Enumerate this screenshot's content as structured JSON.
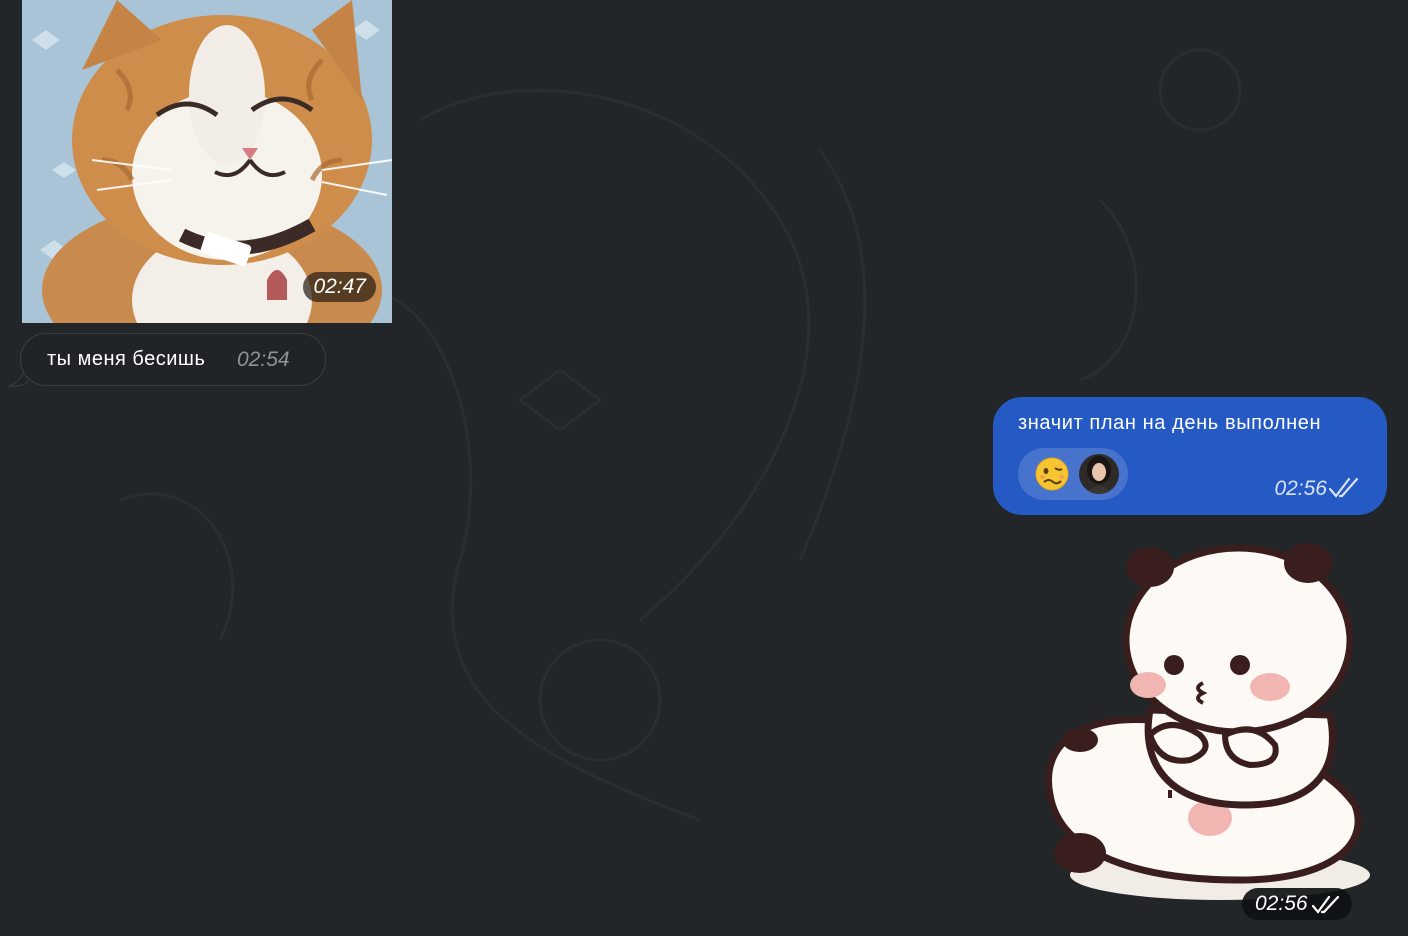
{
  "chat": {
    "background_color": "#232628",
    "messages": [
      {
        "id": "gif",
        "direction": "incoming",
        "kind": "gif",
        "media_desc_icon": "smiling-cat-gif",
        "time": "02:47"
      },
      {
        "id": "text1",
        "direction": "incoming",
        "kind": "text",
        "text": "ты меня бесишь",
        "time": "02:54"
      },
      {
        "id": "text2",
        "direction": "outgoing",
        "kind": "text",
        "text": "значит план на день выполнен",
        "time": "02:56",
        "status_icon": "double-check-icon",
        "reactions": [
          {
            "emoji": "🥴",
            "icon": "woozy-face-icon"
          },
          {
            "icon": "user-avatar"
          }
        ]
      },
      {
        "id": "sticker",
        "direction": "outgoing",
        "kind": "sticker",
        "sticker_icon": "panda-bear-hug-sticker",
        "time": "02:56",
        "status_icon": "double-check-icon"
      }
    ]
  },
  "colors": {
    "outgoing_bubble": "#2559c4",
    "incoming_bubble": "#212426",
    "incoming_time": "#8d9399"
  }
}
